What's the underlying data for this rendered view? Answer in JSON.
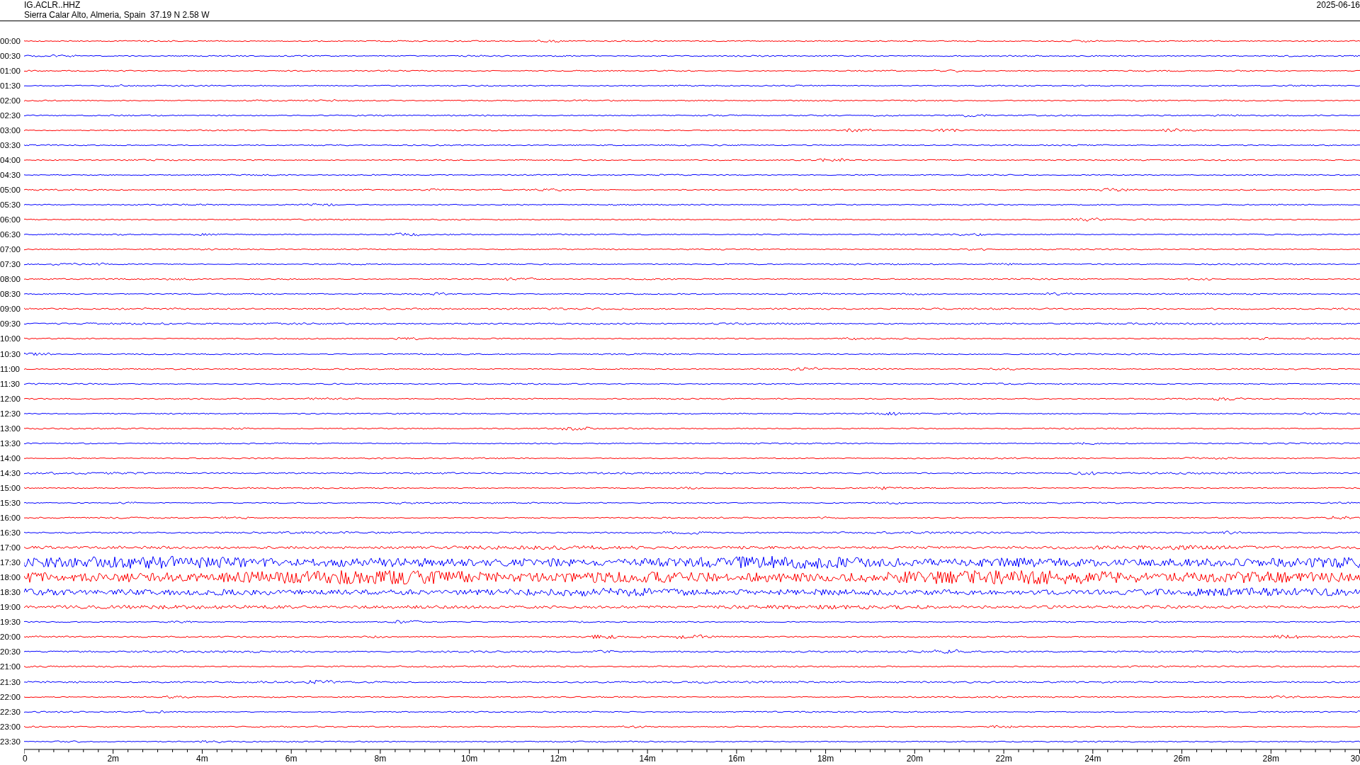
{
  "header": {
    "station": "IG.ACLR..HHZ",
    "location": "Sierra Calar Alto, Almeria, Spain  37.19 N 2.58 W",
    "date": "2025-06-16"
  },
  "rows": [
    {
      "time": "00:00",
      "color": "#ff0000"
    },
    {
      "time": "00:30",
      "color": "#0000ff"
    },
    {
      "time": "01:00",
      "color": "#ff0000"
    },
    {
      "time": "01:30",
      "color": "#0000ff"
    },
    {
      "time": "02:00",
      "color": "#ff0000"
    },
    {
      "time": "02:30",
      "color": "#0000ff"
    },
    {
      "time": "03:00",
      "color": "#ff0000"
    },
    {
      "time": "03:30",
      "color": "#0000ff"
    },
    {
      "time": "04:00",
      "color": "#ff0000"
    },
    {
      "time": "04:30",
      "color": "#0000ff"
    },
    {
      "time": "05:00",
      "color": "#ff0000"
    },
    {
      "time": "05:30",
      "color": "#0000ff"
    },
    {
      "time": "06:00",
      "color": "#ff0000"
    },
    {
      "time": "06:30",
      "color": "#0000ff"
    },
    {
      "time": "07:00",
      "color": "#ff0000"
    },
    {
      "time": "07:30",
      "color": "#0000ff"
    },
    {
      "time": "08:00",
      "color": "#ff0000"
    },
    {
      "time": "08:30",
      "color": "#0000ff"
    },
    {
      "time": "09:00",
      "color": "#ff0000"
    },
    {
      "time": "09:30",
      "color": "#0000ff"
    },
    {
      "time": "10:00",
      "color": "#ff0000"
    },
    {
      "time": "10:30",
      "color": "#0000ff"
    },
    {
      "time": "11:00",
      "color": "#ff0000"
    },
    {
      "time": "11:30",
      "color": "#0000ff"
    },
    {
      "time": "12:00",
      "color": "#ff0000"
    },
    {
      "time": "12:30",
      "color": "#0000ff"
    },
    {
      "time": "13:00",
      "color": "#ff0000"
    },
    {
      "time": "13:30",
      "color": "#0000ff"
    },
    {
      "time": "14:00",
      "color": "#ff0000"
    },
    {
      "time": "14:30",
      "color": "#0000ff"
    },
    {
      "time": "15:00",
      "color": "#ff0000"
    },
    {
      "time": "15:30",
      "color": "#0000ff"
    },
    {
      "time": "16:00",
      "color": "#ff0000"
    },
    {
      "time": "16:30",
      "color": "#0000ff"
    },
    {
      "time": "17:00",
      "color": "#ff0000"
    },
    {
      "time": "17:30",
      "color": "#0000ff"
    },
    {
      "time": "18:00",
      "color": "#ff0000"
    },
    {
      "time": "18:30",
      "color": "#0000ff"
    },
    {
      "time": "19:00",
      "color": "#ff0000"
    },
    {
      "time": "19:30",
      "color": "#0000ff"
    },
    {
      "time": "20:00",
      "color": "#ff0000"
    },
    {
      "time": "20:30",
      "color": "#0000ff"
    },
    {
      "time": "21:00",
      "color": "#ff0000"
    },
    {
      "time": "21:30",
      "color": "#0000ff"
    },
    {
      "time": "22:00",
      "color": "#ff0000"
    },
    {
      "time": "22:30",
      "color": "#0000ff"
    },
    {
      "time": "23:00",
      "color": "#ff0000"
    },
    {
      "time": "23:30",
      "color": "#0000ff"
    }
  ],
  "x_axis": {
    "labels": [
      "0",
      "2m",
      "4m",
      "6m",
      "8m",
      "10m",
      "12m",
      "14m",
      "16m",
      "18m",
      "20m",
      "22m",
      "24m",
      "26m",
      "28m",
      "30"
    ]
  }
}
